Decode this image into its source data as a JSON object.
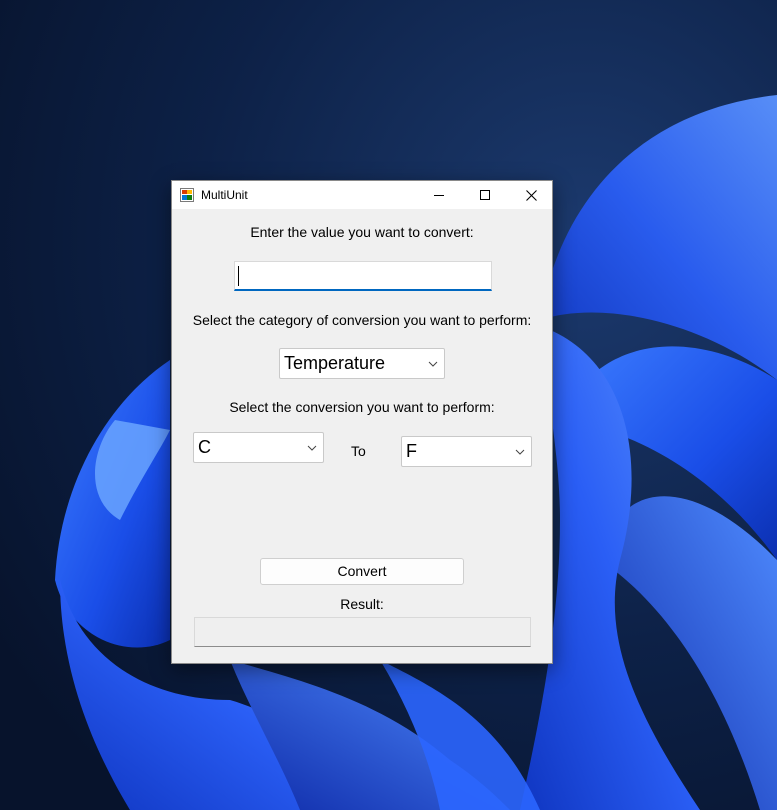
{
  "window": {
    "title": "MultiUnit"
  },
  "titlebar": {
    "minimize_icon": "minimize-icon",
    "maximize_icon": "maximize-icon",
    "close_icon": "close-icon"
  },
  "form": {
    "value_prompt": "Enter the value you want to convert:",
    "value_input": "",
    "category_prompt": "Select the category of conversion you want to perform:",
    "category_selected": "Temperature",
    "conversion_prompt": "Select the conversion you want to perform:",
    "from_unit": "C",
    "to_label": "To",
    "to_unit": "F",
    "convert_label": "Convert",
    "result_label": "Result:",
    "result_value": ""
  },
  "colors": {
    "accent": "#0067c0",
    "window_bg": "#f0f0f0",
    "wallpaper_base": "#0a1a3a",
    "wallpaper_bloom": "#1f5cff"
  }
}
